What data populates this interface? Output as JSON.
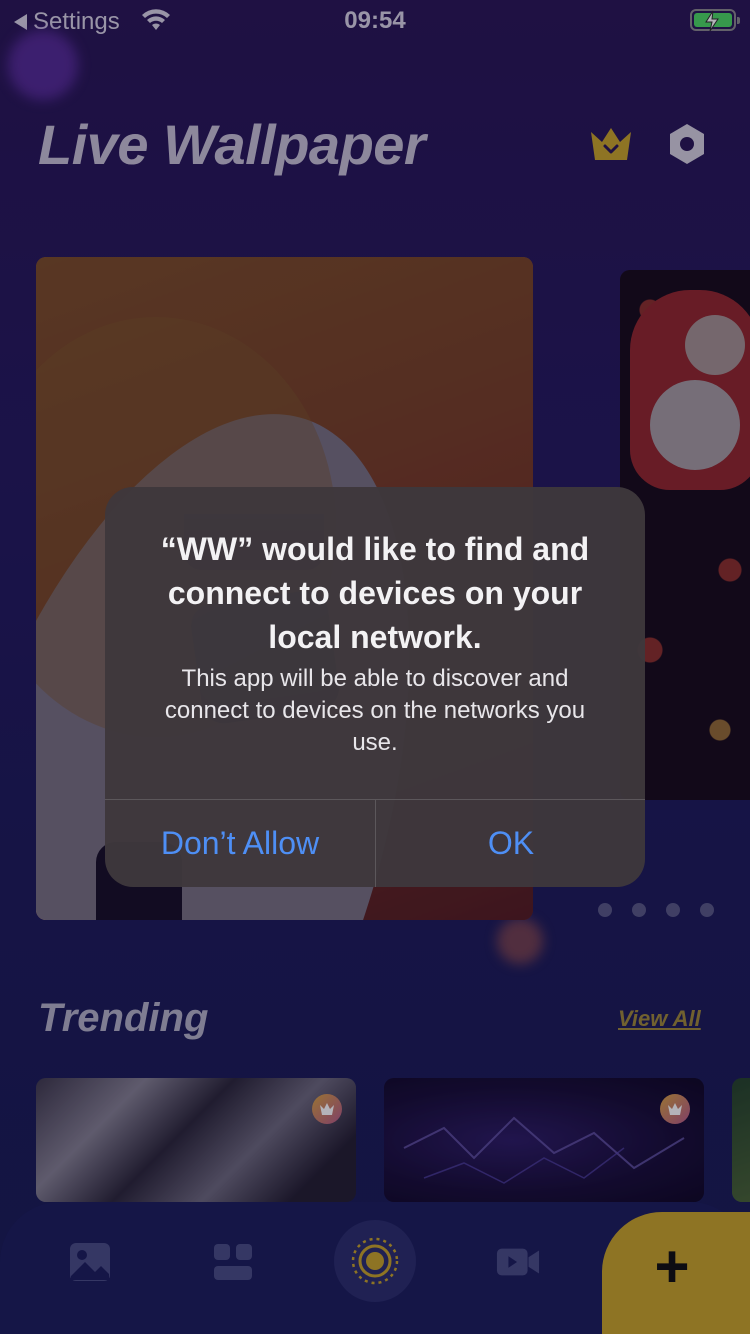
{
  "status_bar": {
    "back_label": "Settings",
    "time": "09:54"
  },
  "header": {
    "title": "Live Wallpaper",
    "crown_icon": "crown-icon",
    "settings_icon": "settings-icon"
  },
  "carousel": {
    "page_count": 4
  },
  "trending": {
    "title": "Trending",
    "view_all_label": "View All"
  },
  "bottom_nav": {
    "items": [
      "image-icon",
      "grid-icon",
      "live-icon",
      "video-icon"
    ],
    "fab_label": "+"
  },
  "alert": {
    "title": "“WW” would like to find and connect to devices on your local network.",
    "message": "This app will be able to discover and connect to devices on the networks you use.",
    "deny_label": "Don’t Allow",
    "ok_label": "OK"
  },
  "colors": {
    "accent_gold": "#c9a52a",
    "alert_button_blue": "#4e8ff5"
  }
}
